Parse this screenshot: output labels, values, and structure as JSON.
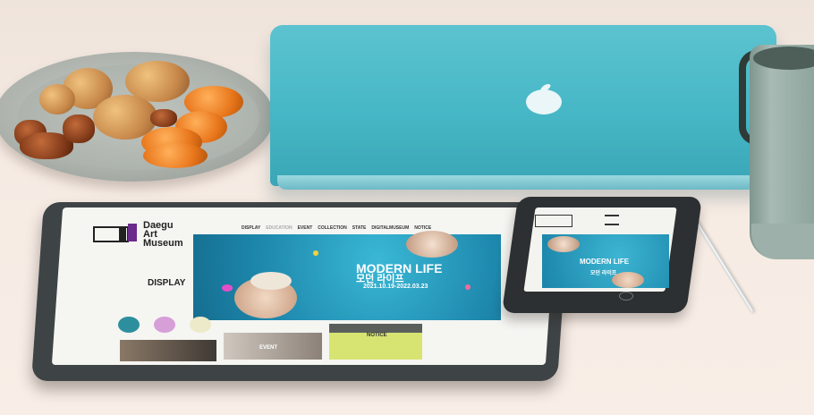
{
  "tablet": {
    "logo": [
      "Daegu",
      "Art",
      "Museum"
    ],
    "nav": [
      "DISPLAY",
      "EDUCATION",
      "EVENT",
      "COLLECTION",
      "STATE",
      "DIGITALMUSEUM",
      "NOTICE"
    ],
    "section_label": "DISPLAY",
    "hero_title": "MODERN LIFE",
    "hero_korean": "모던 라이프",
    "hero_dates": "2021.10.19-2022.03.23",
    "tiles": [
      "EVENT",
      "NOTICE"
    ]
  },
  "phone": {
    "hero_title": "MODERN LIFE",
    "hero_korean": "모던 라이프"
  },
  "colors": {
    "laptop": "#46b7c6",
    "hero": "#1e88ad",
    "notice": "#d7e472"
  }
}
